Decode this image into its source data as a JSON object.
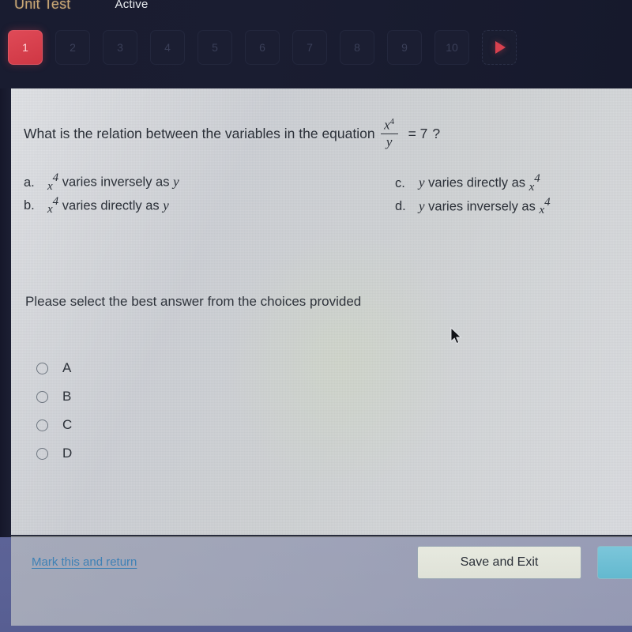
{
  "header": {
    "unit_test_title": "Unit Test",
    "status_label": "Active",
    "tabs": [
      {
        "label": "1",
        "active": true
      },
      {
        "label": "2",
        "active": false
      },
      {
        "label": "3",
        "active": false
      },
      {
        "label": "4",
        "active": false
      },
      {
        "label": "5",
        "active": false
      },
      {
        "label": "6",
        "active": false
      },
      {
        "label": "7",
        "active": false
      },
      {
        "label": "8",
        "active": false
      },
      {
        "label": "9",
        "active": false
      },
      {
        "label": "10",
        "active": false
      }
    ],
    "next_arrow_icon": "play-triangle-icon"
  },
  "question": {
    "prefix": "What is the relation between the variables in the equation",
    "equation": {
      "numerator": "x",
      "numerator_exponent": "4",
      "denominator": "y",
      "equals": "= 7",
      "terminator": "?"
    },
    "choices": [
      {
        "letter": "a.",
        "base": "x",
        "exponent": "4",
        "text": "varies inversely as",
        "variable": "y",
        "var_first": false
      },
      {
        "letter": "b.",
        "base": "x",
        "exponent": "4",
        "text": "varies directly as",
        "variable": "y",
        "var_first": false
      },
      {
        "letter": "c.",
        "base": "x",
        "exponent": "4",
        "text": "varies directly as",
        "variable": "y",
        "var_first": true
      },
      {
        "letter": "d.",
        "base": "x",
        "exponent": "4",
        "text": "varies inversely as",
        "variable": "y",
        "var_first": true
      }
    ],
    "select_prompt": "Please select the best answer from the choices provided"
  },
  "answer_options": [
    {
      "label": "A",
      "selected": false
    },
    {
      "label": "B",
      "selected": false
    },
    {
      "label": "C",
      "selected": false
    },
    {
      "label": "D",
      "selected": false
    }
  ],
  "footer": {
    "mark_return_label": "Mark this and return",
    "save_exit_label": "Save and Exit",
    "next_button_label": ""
  },
  "colors": {
    "header_bg": "#181b2e",
    "active_tab": "#d8414f",
    "title_gold": "#c9a775",
    "content_bg": "#c9ccd2",
    "link_blue": "#3f81b5",
    "next_button_teal": "#6dbfd4",
    "bottom_strip": "#5c6397"
  }
}
